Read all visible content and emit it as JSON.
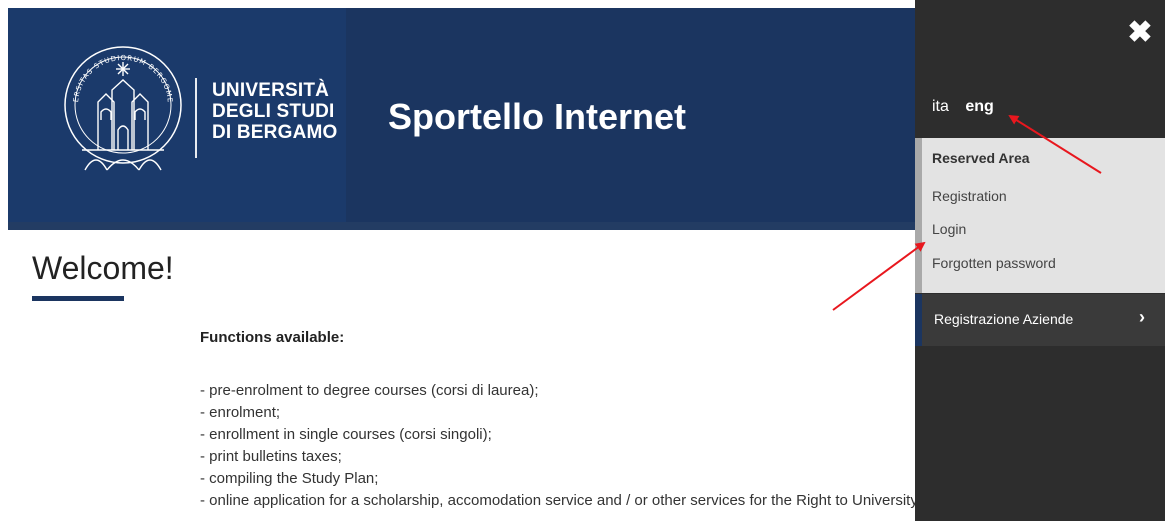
{
  "header": {
    "logo_lines": [
      "UNIVERSITÀ",
      "DEGLI STUDI",
      "DI BERGAMO"
    ],
    "seal_text": "UNIVERSITAS STUDIORUM BERGOMENSIS",
    "site_title": "Sportello Internet"
  },
  "main": {
    "welcome": "Welcome!",
    "functions_heading": "Functions available:",
    "functions": [
      "- pre-enrolment to degree courses (corsi di laurea);",
      "- enrolment;",
      "- enrollment in single courses (corsi singoli);",
      "- print bulletins taxes;",
      "- compiling the Study Plan;",
      "- online application for a scholarship, accomodation service and / or other services for the Right to University Study;"
    ]
  },
  "side_panel": {
    "close_icon": "close-x-icon",
    "languages": [
      {
        "label": "ita",
        "active": false
      },
      {
        "label": "eng",
        "active": true
      }
    ],
    "reserved_area": {
      "title": "Reserved Area",
      "items": [
        "Registration",
        "Login",
        "Forgotten password"
      ]
    },
    "registrazione_aziende": "Registrazione Aziende",
    "chevron_icon": "chevron-right-icon"
  },
  "colors": {
    "header_blue": "#1b3560",
    "panel_dark": "#2d2d2d",
    "reserved_bg": "#e3e3e3",
    "annotation_red": "#e8171e"
  }
}
